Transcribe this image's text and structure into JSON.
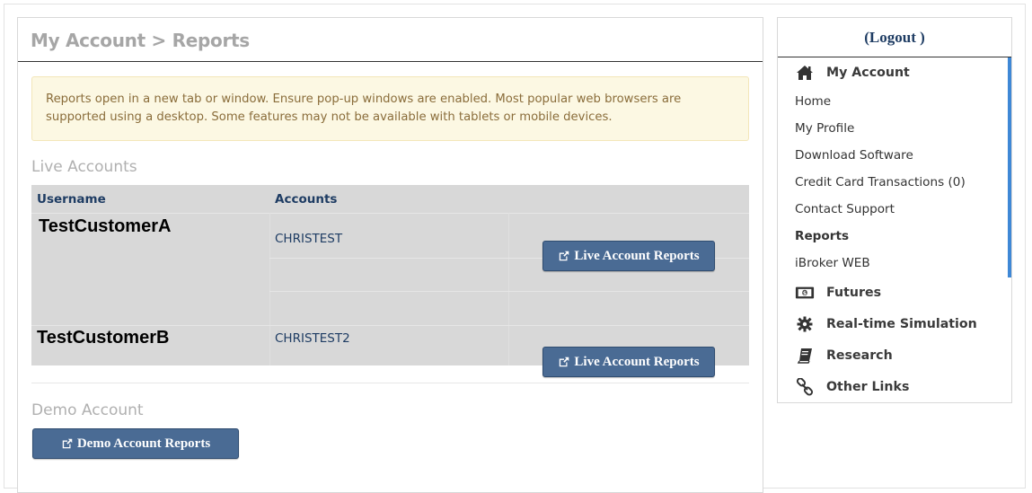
{
  "page": {
    "title": "My Account > Reports",
    "alert": "Reports open in a new tab or window. Ensure pop-up windows are enabled. Most popular web browsers are supported using a desktop. Some features may not be available with tablets or mobile devices."
  },
  "live_accounts": {
    "label": "Live Accounts",
    "headers": {
      "username": "Username",
      "accounts": "Accounts"
    },
    "rows": [
      {
        "username": "TestCustomerA",
        "account": "CHRISTEST",
        "button": "Live Account Reports"
      },
      {
        "username": "TestCustomerB",
        "account": "CHRISTEST2",
        "button": "Live Account Reports"
      }
    ]
  },
  "demo_account": {
    "label": "Demo Account",
    "button": "Demo Account Reports"
  },
  "sidebar": {
    "logout": "(Logout )",
    "my_account": {
      "label": "My Account",
      "icon": "home-icon"
    },
    "items": [
      {
        "label": "Home"
      },
      {
        "label": "My Profile"
      },
      {
        "label": "Download Software"
      },
      {
        "label": "Credit Card Transactions (0)"
      },
      {
        "label": "Contact Support"
      },
      {
        "label": "Reports"
      },
      {
        "label": "iBroker WEB"
      }
    ],
    "sections": [
      {
        "label": "Futures",
        "icon": "money-icon"
      },
      {
        "label": "Real-time Simulation",
        "icon": "gear-icon"
      },
      {
        "label": "Research",
        "icon": "book-icon"
      },
      {
        "label": "Other Links",
        "icon": "link-icon"
      }
    ]
  },
  "colors": {
    "button": "#4a6b94",
    "header_text": "#1e3c63",
    "alert_bg": "#fcf8e3",
    "alert_text": "#8a6d3b",
    "scroll_accent": "#3f88d6"
  }
}
